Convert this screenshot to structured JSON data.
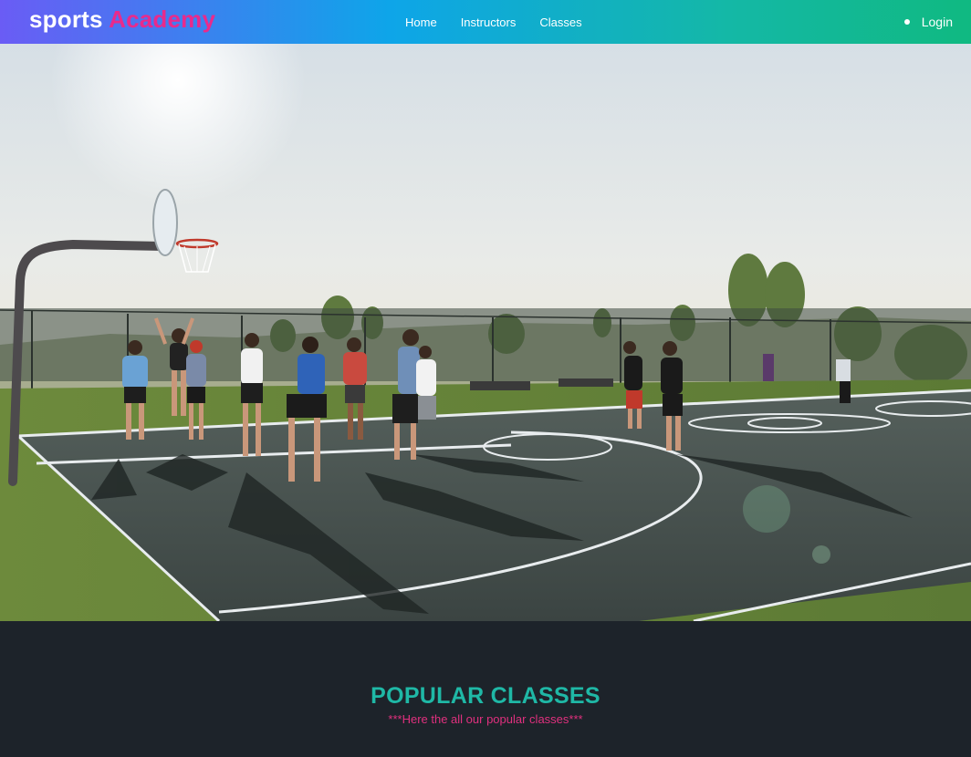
{
  "brand": {
    "word1": "sports",
    "word2": "Academy"
  },
  "nav": {
    "items": [
      {
        "label": "Home"
      },
      {
        "label": "Instructors"
      },
      {
        "label": "Classes"
      }
    ]
  },
  "auth": {
    "login_label": "Login"
  },
  "section": {
    "title": "POPULAR CLASSES",
    "subtitle": "***Here the all our popular classes***"
  },
  "colors": {
    "brand_accent": "#e92a8c",
    "title_teal": "#1fb8a6",
    "subtitle_pink": "#e0307e",
    "dark_bg": "#1d232a"
  }
}
